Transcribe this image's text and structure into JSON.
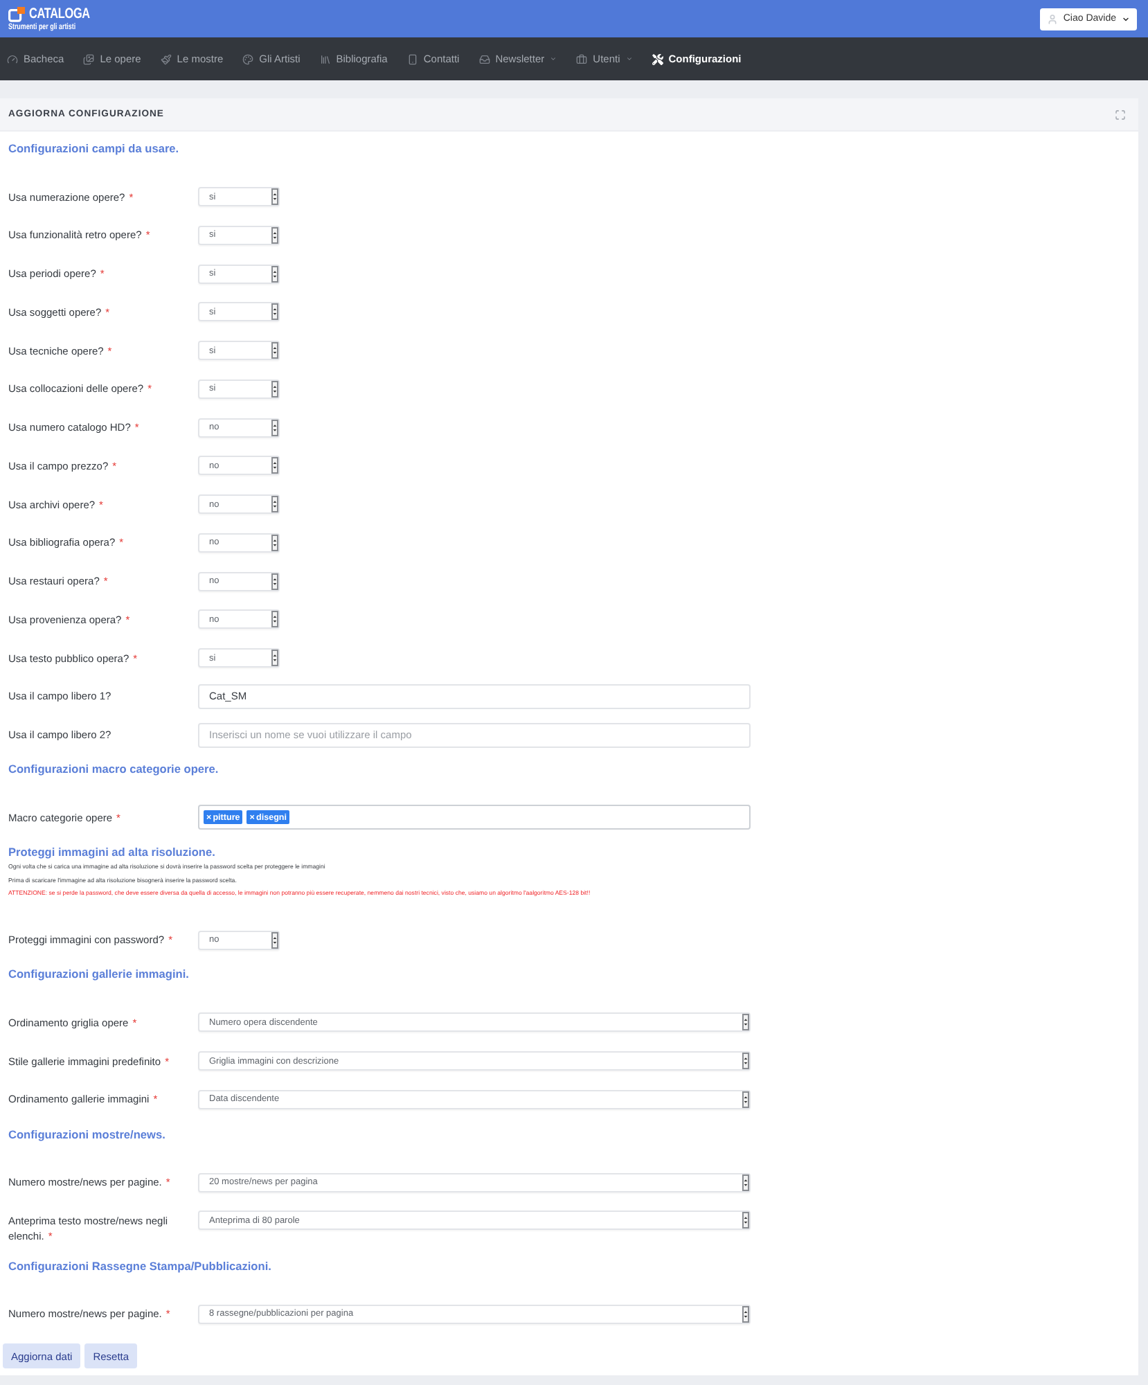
{
  "header": {
    "logo_title": "CATALOGA",
    "logo_subtitle": "Strumenti per gli artisti",
    "user_button": "Ciao Davide"
  },
  "nav": [
    {
      "label": "Bacheca",
      "selected": false,
      "dropdown": false
    },
    {
      "label": "Le opere",
      "selected": false,
      "dropdown": false
    },
    {
      "label": "Le mostre",
      "selected": false,
      "dropdown": false
    },
    {
      "label": "Gli Artisti",
      "selected": false,
      "dropdown": false
    },
    {
      "label": "Bibliografia",
      "selected": false,
      "dropdown": false
    },
    {
      "label": "Contatti",
      "selected": false,
      "dropdown": false
    },
    {
      "label": "Newsletter",
      "selected": false,
      "dropdown": true
    },
    {
      "label": "Utenti",
      "selected": false,
      "dropdown": true
    },
    {
      "label": "Configurazioni",
      "selected": true,
      "dropdown": false
    }
  ],
  "card": {
    "title": "AGGIORNA CONFIGURAZIONE"
  },
  "sections": [
    {
      "heading": "Configurazioni campi da usare.",
      "fields": [
        {
          "kind": "short_select",
          "label": "Usa numerazione opere?",
          "required_mark": "*",
          "value": "si"
        },
        {
          "kind": "short_select",
          "label": "Usa funzionalità retro opere?",
          "required_mark": "*",
          "value": "si"
        },
        {
          "kind": "short_select",
          "label": "Usa periodi opere?",
          "required_mark": "*",
          "value": "si"
        },
        {
          "kind": "short_select",
          "label": "Usa soggetti opere?",
          "required_mark": "*",
          "value": "si"
        },
        {
          "kind": "short_select",
          "label": "Usa tecniche opere?",
          "required_mark": "*",
          "value": "si"
        },
        {
          "kind": "short_select",
          "label": "Usa collocazioni delle opere?",
          "required_mark": "*",
          "value": "si"
        },
        {
          "kind": "short_select",
          "label": "Usa numero catalogo HD?",
          "required_mark": "*",
          "value": "no"
        },
        {
          "kind": "short_select",
          "label": "Usa il campo prezzo?",
          "required_mark": "*",
          "value": "no"
        },
        {
          "kind": "short_select",
          "label": "Usa archivi opere?",
          "required_mark": "*",
          "value": "no"
        },
        {
          "kind": "short_select",
          "label": "Usa bibliografia opera?",
          "required_mark": "*",
          "value": "no"
        },
        {
          "kind": "short_select",
          "label": "Usa restauri opera?",
          "required_mark": "*",
          "value": "no"
        },
        {
          "kind": "short_select",
          "label": "Usa provenienza opera?",
          "required_mark": "*",
          "value": "no"
        },
        {
          "kind": "short_select",
          "label": "Usa testo pubblico opera?",
          "required_mark": "*",
          "value": "si"
        },
        {
          "kind": "text",
          "label": "Usa il campo libero 1?",
          "value": "Cat_SM"
        },
        {
          "kind": "text",
          "label": "Usa il campo libero 2?",
          "placeholder": "Inserisci un nome se vuoi utilizzare il campo"
        }
      ]
    },
    {
      "heading": "Configurazioni macro categorie opere.",
      "fields": [
        {
          "kind": "tags",
          "label": "Macro categorie opere",
          "required_mark": "*",
          "tags": [
            {
              "remove": "×",
              "label": "pitture"
            },
            {
              "remove": "×",
              "label": "disegni"
            }
          ]
        }
      ]
    },
    {
      "heading": "Proteggi immagini ad alta risoluzione.",
      "notes": [
        {
          "kind": "info",
          "text": "Ogni volta che si carica una immagine ad alta risoluzione si dovrà inserire la password scelta per proteggere le immagini"
        },
        {
          "kind": "info",
          "text": "Prima di scaricare l'immagine ad alta risoluzione bisognerà inserire la password scelta."
        },
        {
          "kind": "warning",
          "text": "ATTENZIONE: se si perde la password, che deve essere diversa da quella di accesso, le immagini non potranno più essere recuperate, nemmeno dai nostri tecnici, visto che, usiamo un algoritmo l'aalgoritmo AES-128 bit!!"
        }
      ],
      "fields": [
        {
          "kind": "short_select",
          "label": "Proteggi immagini con password?",
          "required_mark": "*",
          "value": "no"
        }
      ]
    },
    {
      "heading": "Configurazioni gallerie immagini.",
      "fields": [
        {
          "kind": "select",
          "label": "Ordinamento griglia opere",
          "required_mark": "*",
          "value": "Numero opera discendente"
        },
        {
          "kind": "select",
          "label": "Stile gallerie immagini predefinito",
          "required_mark": "*",
          "value": "Griglia immagini con descrizione"
        },
        {
          "kind": "select",
          "label": "Ordinamento gallerie immagini",
          "required_mark": "*",
          "value": "Data discendente"
        }
      ]
    },
    {
      "heading": "Configurazioni mostre/news.",
      "fields": [
        {
          "kind": "select",
          "label": "Numero mostre/news per pagine.",
          "required_mark": "*",
          "value": "20 mostre/news per pagina"
        },
        {
          "kind": "select",
          "label": "Anteprima testo mostre/news negli elenchi.",
          "required_mark": "*",
          "value": "Anteprima di 80 parole"
        }
      ]
    },
    {
      "heading": "Configurazioni Rassegne Stampa/Pubblicazioni.",
      "fields": [
        {
          "kind": "select",
          "label": "Numero mostre/news per pagine.",
          "required_mark": "*",
          "value": "8 rassegne/pubblicazioni per pagina"
        }
      ]
    }
  ],
  "buttons": [
    "Aggiorna dati",
    "Resetta"
  ]
}
